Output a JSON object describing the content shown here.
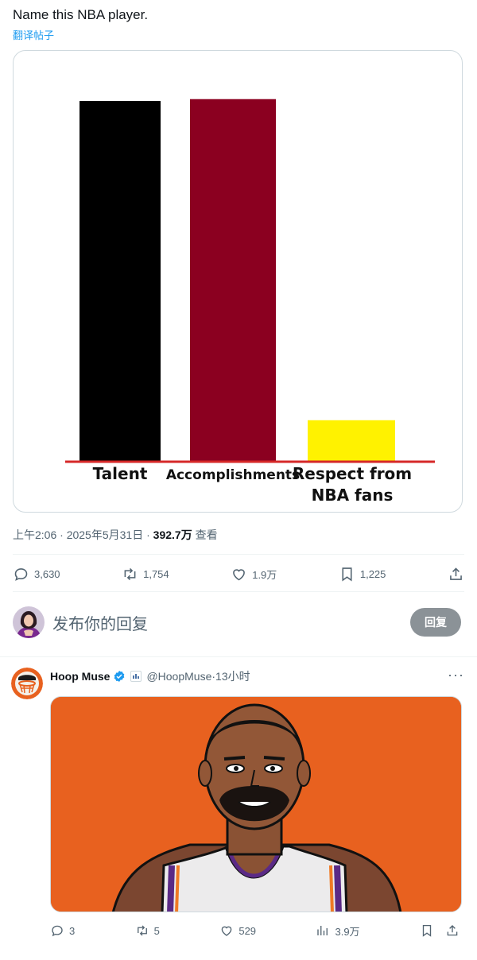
{
  "post": {
    "text": "Name this NBA player.",
    "translate_label": "翻译帖子",
    "meta_time": "上午2:06",
    "meta_sep1": " · ",
    "meta_date": "2025年5月31日",
    "meta_sep2": " · ",
    "views_count": "392.7万",
    "views_label": " 查看"
  },
  "chart_data": {
    "type": "bar",
    "title": "",
    "xlabel": "",
    "ylabel": "",
    "categories": [
      "Talent",
      "Accomplishments",
      "Respect from NBA fans"
    ],
    "category_lines": [
      [
        "Talent"
      ],
      [
        "Accomplishments"
      ],
      [
        "Respect from",
        "NBA fans"
      ]
    ],
    "values": [
      100,
      100.5,
      11.5
    ],
    "ylim": [
      0,
      100
    ],
    "colors": [
      "#000000",
      "#8b0020",
      "#fff200"
    ],
    "baseline_color": "#d62828",
    "axes_visible": false,
    "grid": false
  },
  "actions": {
    "replies": "3,630",
    "reposts": "1,754",
    "likes": "1.9万",
    "bookmarks": "1,225"
  },
  "reply_box": {
    "placeholder": "发布你的回复",
    "button_label": "回复"
  },
  "reply_tweet": {
    "name": "Hoop Muse",
    "handle": "@HoopMuse",
    "sep": " · ",
    "time": "13小时",
    "more": "···",
    "replies": "3",
    "reposts": "5",
    "likes": "529",
    "views": "3.9万"
  },
  "colors": {
    "accent": "#1d9bf0",
    "muted": "#536471",
    "reply_button": "#8b9297",
    "image_bg": "#e8611f"
  }
}
